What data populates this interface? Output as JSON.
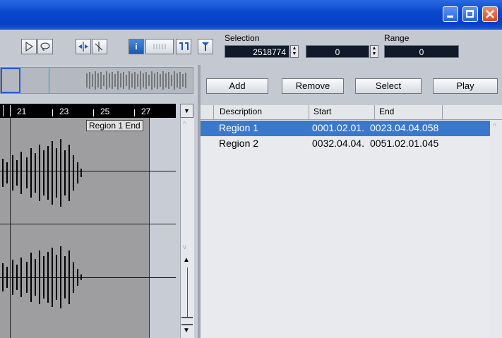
{
  "window": {
    "minimize_icon": "minimize-icon",
    "maximize_icon": "maximize-icon",
    "close_icon": "close-icon"
  },
  "toolbar": {
    "selection_label": "Selection",
    "selection_value": "2518774",
    "field2_value": "0",
    "range_label": "Range",
    "range_value": "0",
    "info_button": "i"
  },
  "ruler": {
    "ticks": [
      "21",
      "23",
      "25",
      "27"
    ]
  },
  "waveform": {
    "region_marker": "Region 1 End"
  },
  "regions": {
    "buttons": {
      "add": "Add",
      "remove": "Remove",
      "select": "Select",
      "play": "Play"
    },
    "columns": {
      "description": "Description",
      "start": "Start",
      "end": "End"
    },
    "rows": [
      {
        "description": "Region 1",
        "start": "0001.02.01.",
        "end": "0023.04.04.058",
        "selected": true
      },
      {
        "description": "Region 2",
        "start": "0032.04.04.",
        "end": "0051.02.01.045",
        "selected": false
      }
    ]
  },
  "colors": {
    "title_bar": "#0a48d0",
    "selection_highlight": "#3a78cc",
    "field_bg": "#111a2a"
  }
}
